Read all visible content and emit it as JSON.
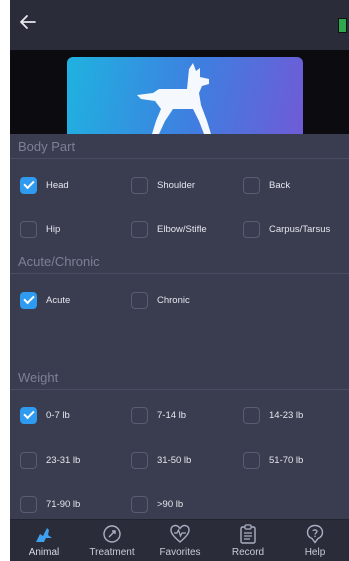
{
  "header": {
    "back_icon": "arrow-left-icon",
    "corner_icon": "app-badge-icon"
  },
  "hero": {
    "image": "dog-walking-banner"
  },
  "sections": [
    {
      "title": "Body Part",
      "options": [
        {
          "label": "Head",
          "checked": true
        },
        {
          "label": "Shoulder",
          "checked": false
        },
        {
          "label": "Back",
          "checked": false
        },
        {
          "label": "Hip",
          "checked": false
        },
        {
          "label": "Elbow/Stifle",
          "checked": false
        },
        {
          "label": "Carpus/Tarsus",
          "checked": false
        }
      ]
    },
    {
      "title": "Acute/Chronic",
      "options": [
        {
          "label": "Acute",
          "checked": true
        },
        {
          "label": "Chronic",
          "checked": false
        }
      ]
    },
    {
      "title": "Weight",
      "options": [
        {
          "label": "0-7 lb",
          "checked": true
        },
        {
          "label": "7-14 lb",
          "checked": false
        },
        {
          "label": "14-23 lb",
          "checked": false
        },
        {
          "label": "23-31 lb",
          "checked": false
        },
        {
          "label": "31-50 lb",
          "checked": false
        },
        {
          "label": "51-70 lb",
          "checked": false
        },
        {
          "label": "71-90 lb",
          "checked": false
        },
        {
          "label": ">90 lb",
          "checked": false
        }
      ]
    }
  ],
  "nav": [
    {
      "label": "Animal",
      "icon": "animal-icon",
      "active": true
    },
    {
      "label": "Treatment",
      "icon": "treatment-icon",
      "active": false
    },
    {
      "label": "Favorites",
      "icon": "heart-icon",
      "active": false
    },
    {
      "label": "Record",
      "icon": "clipboard-icon",
      "active": false
    },
    {
      "label": "Help",
      "icon": "help-icon",
      "active": false
    }
  ],
  "colors": {
    "accent": "#2e9bf0",
    "background": "#3a3d50",
    "bar": "#2a2c3a"
  }
}
